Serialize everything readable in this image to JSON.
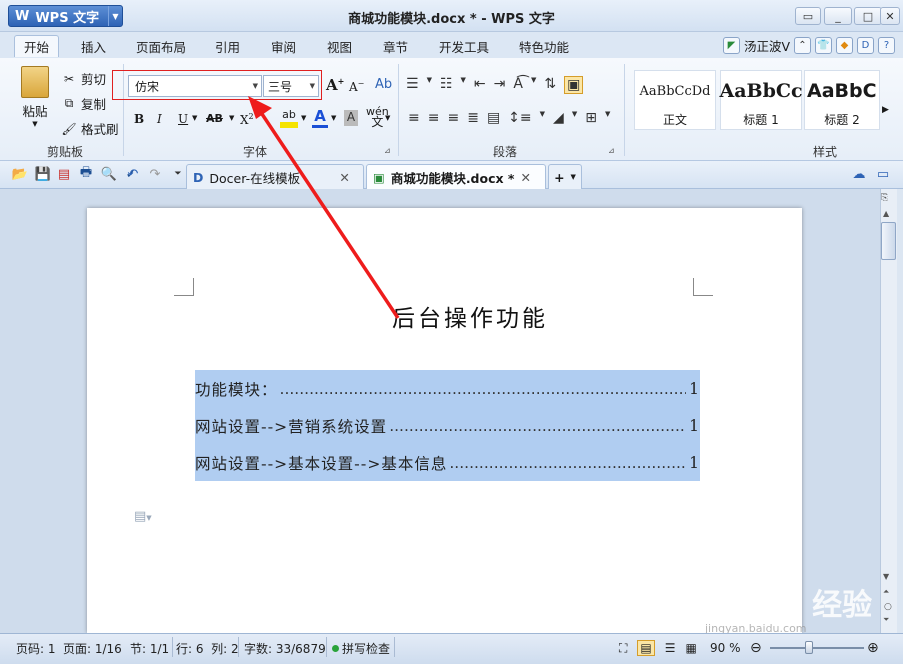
{
  "app": {
    "name": "WPS 文字",
    "window_title": "商城功能模块.docx * - WPS 文字"
  },
  "ribbon_tabs": [
    "开始",
    "插入",
    "页面布局",
    "引用",
    "审阅",
    "视图",
    "章节",
    "开发工具",
    "特色功能"
  ],
  "user": {
    "name": "汤正波V"
  },
  "clipboard": {
    "paste": "粘贴",
    "cut": "剪切",
    "copy": "复制",
    "format_painter": "格式刷",
    "group": "剪贴板"
  },
  "font": {
    "name": "仿宋",
    "size": "三号",
    "group": "字体",
    "bold": "B",
    "italic": "I",
    "underline": "U",
    "strike": "AB",
    "superscript": "X",
    "phonetic": "wén",
    "grow": "A",
    "shrink": "A"
  },
  "paragraph": {
    "group": "段落"
  },
  "styles": {
    "group": "样式",
    "items": [
      {
        "preview": "AaBbCcDd",
        "name": "正文"
      },
      {
        "preview": "AaBbCc",
        "name": "标题 1"
      },
      {
        "preview": "AaBbC",
        "name": "标题 2"
      }
    ]
  },
  "doc_tabs": [
    {
      "label": "Docer-在线模板"
    },
    {
      "label": "商城功能模块.docx *"
    }
  ],
  "document": {
    "heading": "后台操作功能",
    "toc": [
      {
        "text": "功能模块：",
        "page": "1"
      },
      {
        "text": "网站设置-->营销系统设置",
        "page": "1"
      },
      {
        "text": "网站设置-->基本设置-->基本信息",
        "page": "1"
      }
    ]
  },
  "status": {
    "page_num": "页码: 1",
    "page": "页面: 1/16",
    "section": "节: 1/1",
    "row_col": "行: 6  列: 2",
    "word_count": "字数: 33/6879",
    "spell": "拼写检查",
    "zoom": "90 %"
  },
  "watermark": {
    "brand": "Bai du 经验",
    "url": "jingyan.baidu.com"
  },
  "colors": {
    "accent": "#2e63b5",
    "highlight_box": "#e02020",
    "selection": "#b0cdf1"
  }
}
